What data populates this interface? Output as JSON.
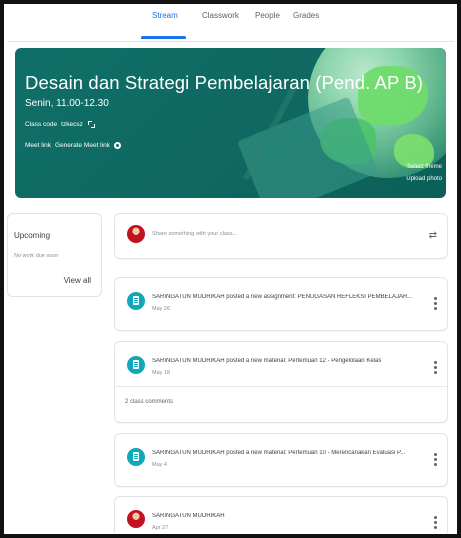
{
  "tabs": [
    "Stream",
    "Classwork",
    "People",
    "Grades"
  ],
  "banner": {
    "title": "Desain dan Strategi Pembelajaran (Pend. AP B)",
    "subtitle": "Senin, 11.00-12.30",
    "class_code_label": "Class code",
    "class_code_value": "tzkecsz",
    "meet_link_label": "Meet link",
    "generate_meet_link": "Generate Meet link",
    "select_theme": "Select theme",
    "upload_photo": "Upload photo"
  },
  "upcoming": {
    "title": "Upcoming",
    "empty": "No work due soon",
    "view_all": "View all"
  },
  "share": {
    "placeholder": "Share something with your class..."
  },
  "posts": [
    {
      "text": "SARINGATUN MUDRIKAH posted a new assignment: PENUGASAN REFLEKSI PEMBELAJAR...",
      "date": "May 26"
    },
    {
      "text": "SARINGATUN MUDRIKAH posted a new material: Pertemuan 12 - Pengelolaan Kelas",
      "date": "May 18",
      "comments": "2 class comments"
    },
    {
      "text": "SARINGATUN MUDRIKAH posted a new material: Pertemuan 10 - Merencanakan Evaluasi P...",
      "date": "May 4"
    },
    {
      "text": "SARINGATUN MUDRIKAH",
      "date": "Apr 27"
    }
  ],
  "colors": {
    "accent": "#1a73e8",
    "banner": "#0f6f68",
    "material_icon": "#11a7b9"
  }
}
